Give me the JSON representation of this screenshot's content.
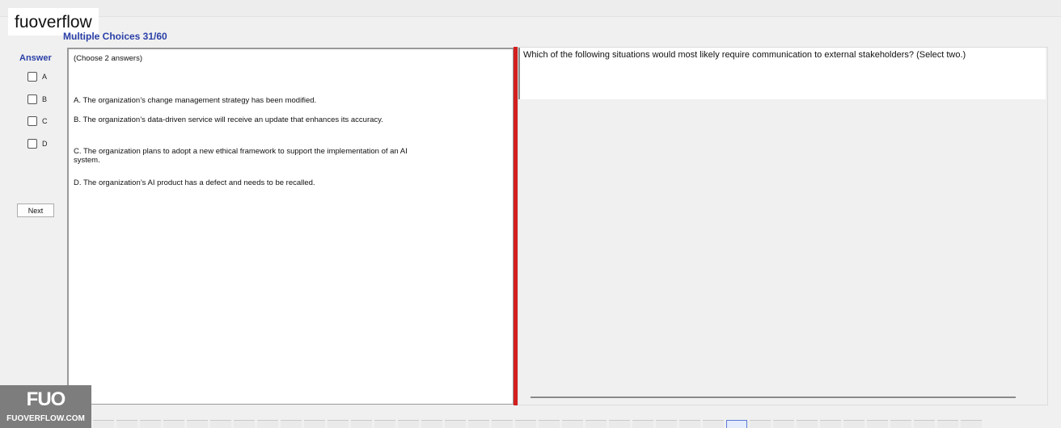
{
  "watermark": {
    "text": "fuoverflow"
  },
  "section": {
    "title": "Multiple Choices 31/60"
  },
  "answer_panel": {
    "label": "Answer",
    "choices": [
      "A",
      "B",
      "C",
      "D"
    ],
    "next_label": "Next"
  },
  "content": {
    "instruction": "(Choose 2 answers)",
    "options": [
      "A.  The organization’s change management strategy has been modified.",
      "B.  The organization’s data-driven service will receive an update that enhances its accuracy.",
      "C.  The organization plans to adopt a new ethical framework to support the implementation of an AI system.",
      "D.  The organization’s AI product has a defect and needs to be recalled."
    ]
  },
  "question": {
    "text": "Which of the following situations would most likely require communication to external stakeholders? (Select two.)"
  },
  "logo": {
    "mark": "FUO",
    "site": "FUOVERFLOW.COM"
  },
  "colors": {
    "accent": "#2a3fa8",
    "divider": "#d21f1f"
  }
}
